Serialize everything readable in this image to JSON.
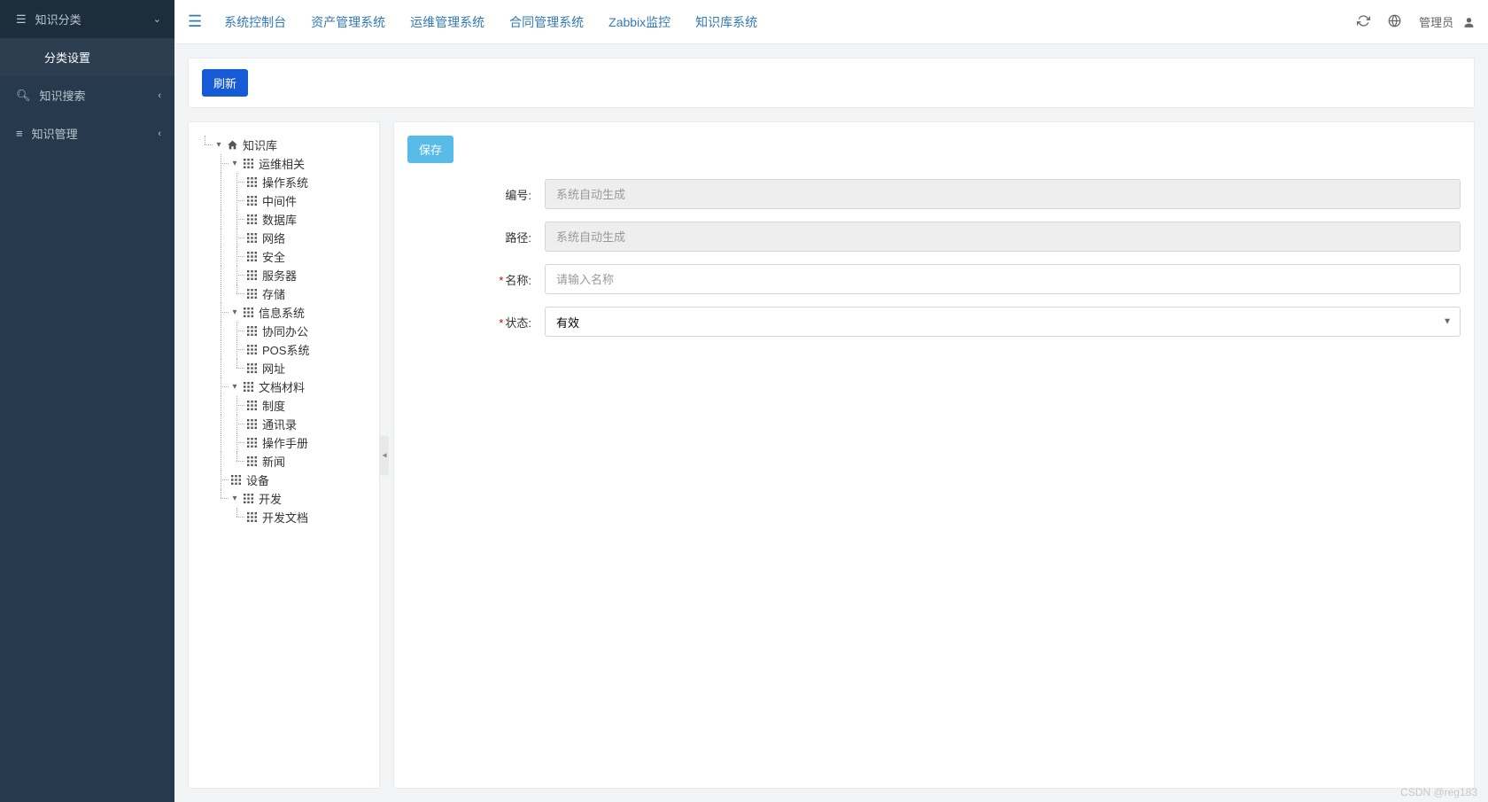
{
  "sidebar": {
    "items": [
      {
        "icon": "list",
        "label": "知识分类",
        "expanded": true,
        "sub": "分类设置"
      },
      {
        "icon": "search",
        "label": "知识搜索"
      },
      {
        "icon": "bars",
        "label": "知识管理"
      }
    ]
  },
  "header": {
    "nav": [
      "系统控制台",
      "资产管理系统",
      "运维管理系统",
      "合同管理系统",
      "Zabbix监控",
      "知识库系统"
    ],
    "user": "管理员"
  },
  "actions": {
    "refresh": "刷新",
    "save": "保存"
  },
  "tree": {
    "root": "知识库",
    "nodes": [
      {
        "label": "运维相关",
        "children": [
          "操作系统",
          "中间件",
          "数据库",
          "网络",
          "安全",
          "服务器",
          "存储"
        ]
      },
      {
        "label": "信息系统",
        "children": [
          "协同办公",
          "POS系统",
          "网址"
        ]
      },
      {
        "label": "文档材料",
        "children": [
          "制度",
          "通讯录",
          "操作手册",
          "新闻"
        ]
      },
      {
        "label": "设备",
        "children": []
      },
      {
        "label": "开发",
        "children": [
          "开发文档"
        ]
      }
    ]
  },
  "form": {
    "code_label": "编号:",
    "code_placeholder": "系统自动生成",
    "path_label": "路径:",
    "path_placeholder": "系统自动生成",
    "name_label": "名称:",
    "name_placeholder": "请输入名称",
    "status_label": "状态:",
    "status_value": "有效"
  },
  "watermark": "CSDN @reg183"
}
